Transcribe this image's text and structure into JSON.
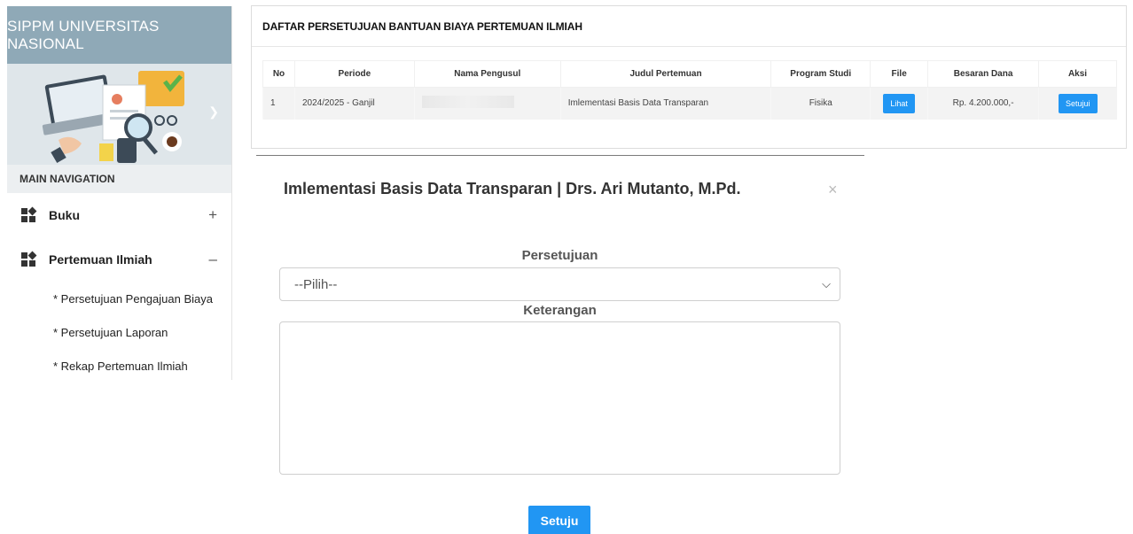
{
  "sidebar": {
    "brand": "SIPPM UNIVERSITAS NASIONAL",
    "main_nav_label": "MAIN NAVIGATION",
    "items": [
      {
        "label": "Buku",
        "toggle": "+"
      },
      {
        "label": "Pertemuan Ilmiah",
        "toggle": "–"
      }
    ],
    "sub_items": [
      "* Persetujuan Pengajuan Biaya",
      "* Persetujuan Laporan",
      "* Rekap Pertemuan Ilmiah"
    ]
  },
  "card": {
    "title": "DAFTAR PERSETUJUAN BANTUAN BIAYA PERTEMUAN ILMIAH",
    "columns": [
      "No",
      "Periode",
      "Nama Pengusul",
      "Judul Pertemuan",
      "Program Studi",
      "File",
      "Besaran Dana",
      "Aksi"
    ],
    "rows": [
      {
        "no": "1",
        "periode": "2024/2025 - Ganjil",
        "nama_pengusul": "",
        "judul": "Imlementasi Basis Data Transparan",
        "prodi": "Fisika",
        "file_button": "Lihat",
        "dana": "Rp. 4.200.000,-",
        "aksi_button": "Setujui"
      }
    ]
  },
  "modal": {
    "title": "Imlementasi Basis Data Transparan | Drs. Ari Mutanto, M.Pd.",
    "close": "×",
    "persetujuan_label": "Persetujuan",
    "persetujuan_value": "--Pilih--",
    "keterangan_label": "Keterangan",
    "keterangan_value": "",
    "submit_label": "Setuju"
  },
  "colors": {
    "brand_bg": "#8fa9b7",
    "accent": "#2196f3"
  }
}
